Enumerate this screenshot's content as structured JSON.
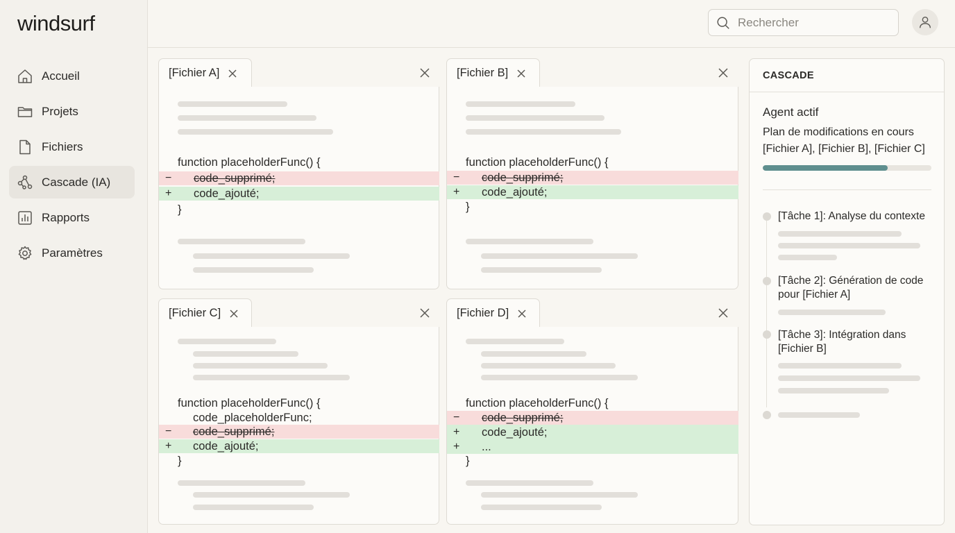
{
  "app": {
    "logo": "windsurf"
  },
  "sidebar": {
    "items": [
      {
        "label": "Accueil",
        "icon": "home-icon",
        "active": false
      },
      {
        "label": "Projets",
        "icon": "folder-icon",
        "active": false
      },
      {
        "label": "Fichiers",
        "icon": "file-icon",
        "active": false
      },
      {
        "label": "Cascade (IA)",
        "icon": "cascade-icon",
        "active": true
      },
      {
        "label": "Rapports",
        "icon": "chart-icon",
        "active": false
      },
      {
        "label": "Paramètres",
        "icon": "gear-icon",
        "active": false
      }
    ]
  },
  "search": {
    "placeholder": "Rechercher"
  },
  "panes": [
    {
      "tab": "[Fichier A]",
      "code_head": "function placeholderFunc() {",
      "del": "code_supprimé;",
      "add": "code_ajouté;",
      "close_brace": "}"
    },
    {
      "tab": "[Fichier B]",
      "code_head": "function placeholderFunc() {",
      "del": "code_supprimé;",
      "add": "code_ajouté;",
      "close_brace": "}"
    },
    {
      "tab": "[Fichier C]",
      "code_head": "function placeholderFunc() {",
      "context": "code_placeholderFunc;",
      "del": "code_supprimé;",
      "add": "code_ajouté;",
      "close_brace": "}"
    },
    {
      "tab": "[Fichier D]",
      "code_head": "function placeholderFunc() {",
      "del": "code_supprimé;",
      "add": "code_ajouté;",
      "add2": "...",
      "close_brace": "}"
    }
  ],
  "diff_marks": {
    "del": "−",
    "add": "+"
  },
  "cascade": {
    "header": "CASCADE",
    "agent_title": "Agent actif",
    "agent_desc": "Plan de modifications en cours [Fichier A], [Fichier B], [Fichier C]",
    "progress_fraction": 0.74,
    "tasks": [
      "[Tâche 1]: Analyse du contexte",
      "[Tâche 2]: Génération de code pour [Fichier A]",
      "[Tâche 3]: Intégration dans [Fichier B]"
    ]
  }
}
